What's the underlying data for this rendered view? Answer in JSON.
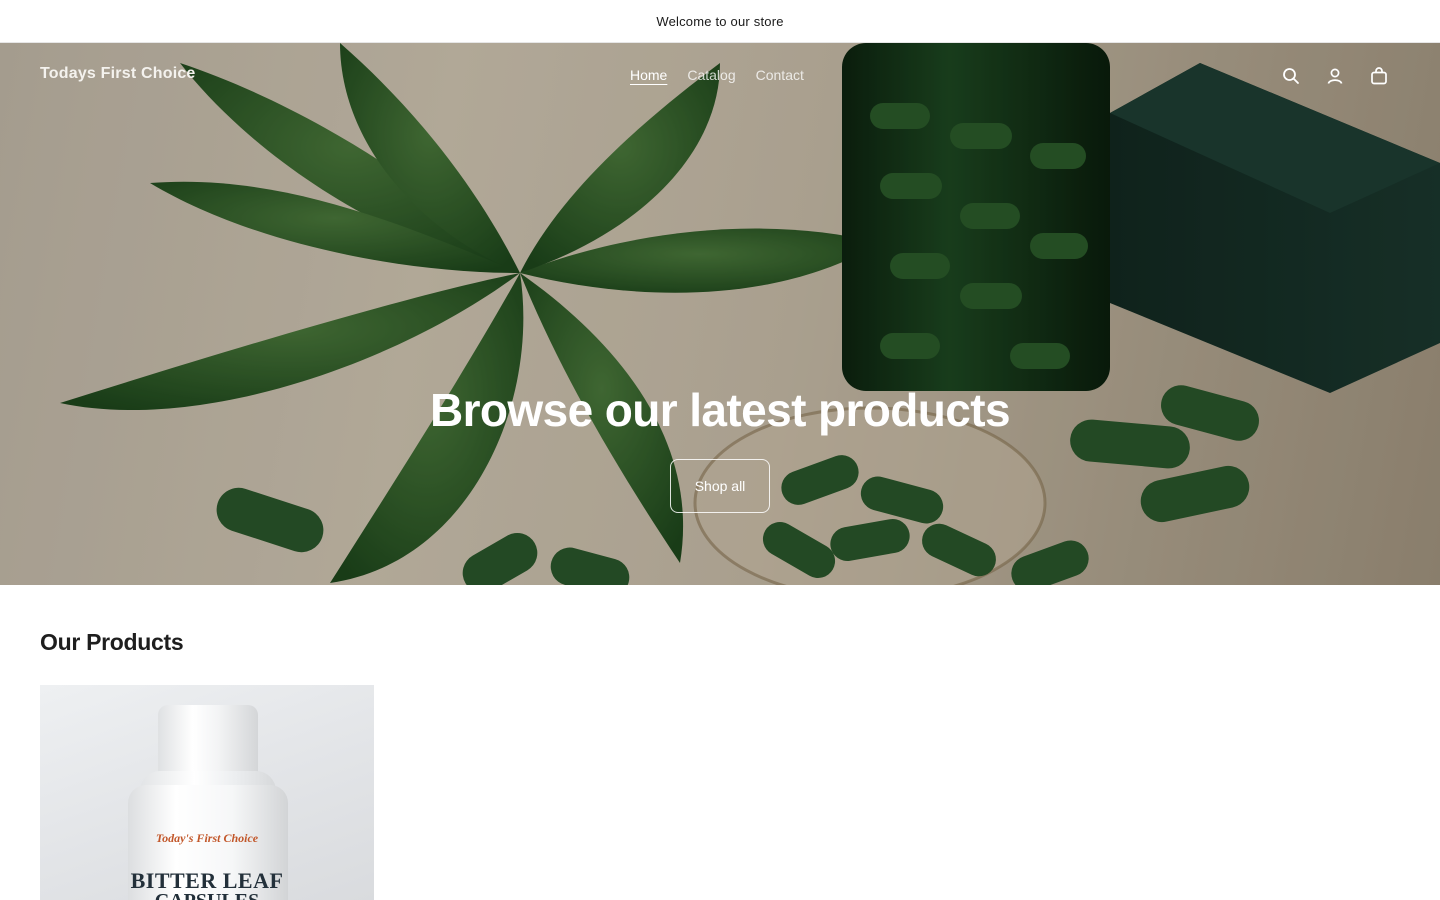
{
  "announcement": {
    "text": "Welcome to our store"
  },
  "header": {
    "logo": "Todays First Choice",
    "nav": [
      {
        "label": "Home",
        "active": true
      },
      {
        "label": "Catalog",
        "active": false
      },
      {
        "label": "Contact",
        "active": false
      }
    ],
    "icons": [
      "search-icon",
      "account-icon",
      "cart-icon"
    ]
  },
  "hero": {
    "title": "Browse our latest products",
    "button": "Shop all"
  },
  "products_section": {
    "title": "Our Products",
    "products": [
      {
        "image_brand_text": "Today's First Choice",
        "image_name_text": "BITTER LEAF",
        "image_name_text_2": "CAPSULES"
      }
    ]
  },
  "colors": {
    "leaf": "#2f5a2a",
    "capsule": "#2b5a2c",
    "brand_label": "#c2572a"
  }
}
